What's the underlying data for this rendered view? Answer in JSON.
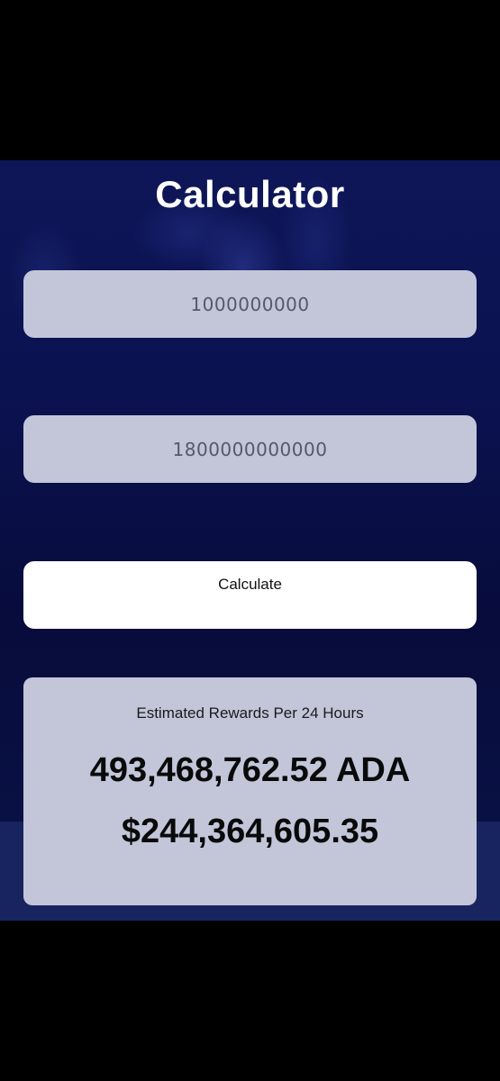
{
  "app": {
    "title": "Calculator"
  },
  "inputs": {
    "first": {
      "value": "1000000000"
    },
    "second": {
      "value": "1800000000000"
    }
  },
  "actions": {
    "calculate_label": "Calculate"
  },
  "result": {
    "label": "Estimated Rewards Per 24 Hours",
    "ada_amount": "493,468,762.52 ADA",
    "usd_amount": "$244,364,605.35"
  },
  "colors": {
    "background": "#0b1250",
    "field_fill": "#c3c6d9",
    "button_fill": "#ffffff",
    "title_text": "#ffffff"
  }
}
